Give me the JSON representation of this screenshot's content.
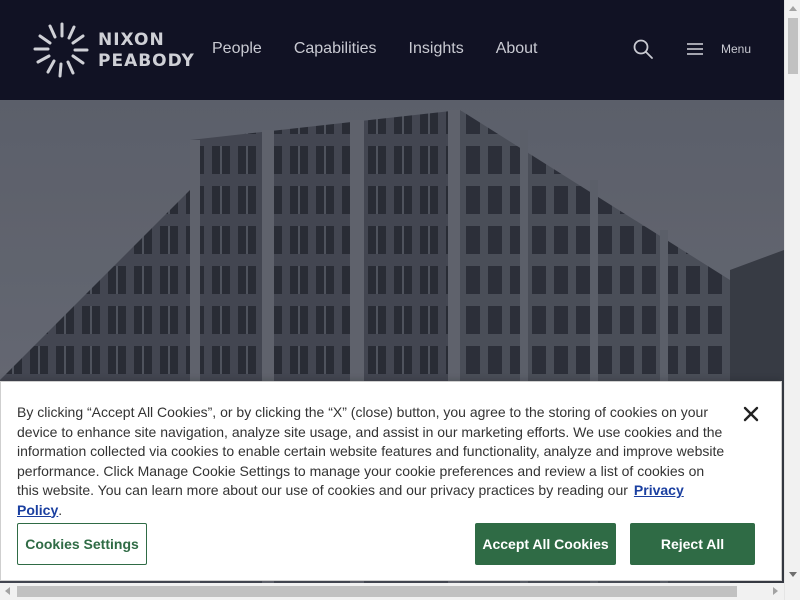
{
  "header": {
    "logo_line1": "NIXON",
    "logo_line2": "PEABODY",
    "nav": [
      "People",
      "Capabilities",
      "Insights",
      "About"
    ],
    "menu_label": "Menu",
    "search_icon": "search-icon",
    "menu_icon": "hamburger-icon"
  },
  "cookie_banner": {
    "text": "By clicking “Accept All Cookies”, or by clicking the “X” (close) button, you agree to the storing of cookies on your device to enhance site navigation, analyze site usage, and assist in our marketing efforts. We use cookies and the information collected via cookies to enable certain website features and functionality, analyze and improve website performance. Click Manage Cookie Settings to manage your cookie preferences and review a list of cookies on this website. You can learn more about our use of cookies and our privacy practices by reading our",
    "privacy_link": "Privacy Policy",
    "period": ".",
    "settings_button": "Cookies Settings",
    "accept_button": "Accept All Cookies",
    "reject_button": "Reject All",
    "close_icon": "close-icon"
  },
  "colors": {
    "header_bg": "#111224",
    "button_green": "#2f6b45",
    "link_blue": "#1a3fa0"
  }
}
